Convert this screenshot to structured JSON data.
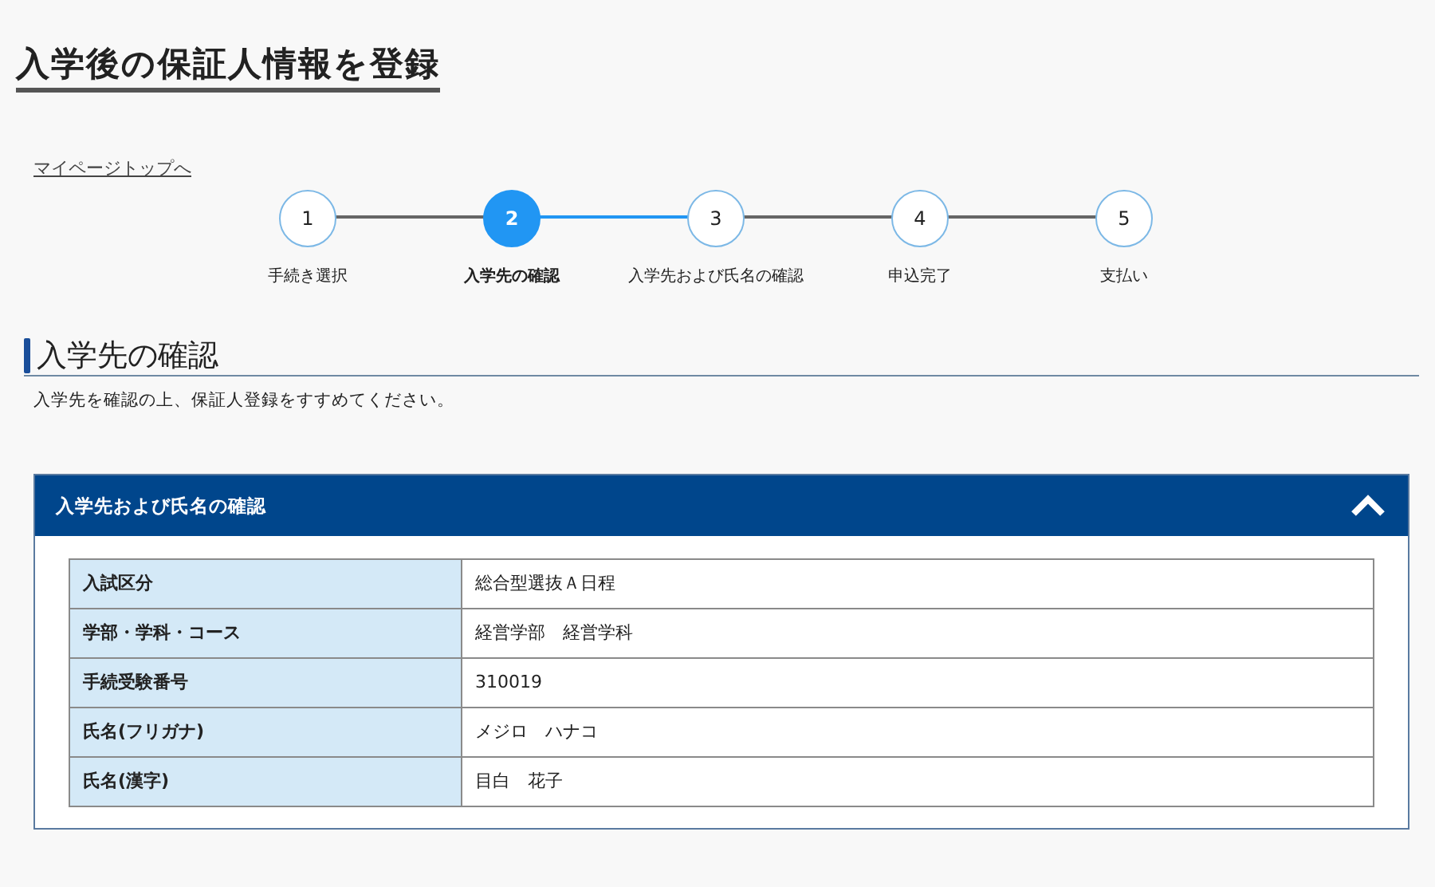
{
  "page_title": "入学後の保証人情報を登録",
  "back_link": "マイページトップへ",
  "steps": [
    {
      "number": "1",
      "label": "手続き選択",
      "selected": false
    },
    {
      "number": "2",
      "label": "入学先の確認",
      "selected": true
    },
    {
      "number": "3",
      "label": "入学先および氏名の確認",
      "selected": false
    },
    {
      "number": "4",
      "label": "申込完了",
      "selected": false
    },
    {
      "number": "5",
      "label": "支払い",
      "selected": false
    }
  ],
  "section": {
    "heading": "入学先の確認",
    "description": "入学先を確認の上、保証人登録をすすめてください。"
  },
  "panel": {
    "title": "入学先および氏名の確認",
    "expanded": true,
    "rows": [
      {
        "label": "入試区分",
        "value": "総合型選抜Ａ日程"
      },
      {
        "label": "学部・学科・コース",
        "value": "経営学部　経営学科"
      },
      {
        "label": "手続受験番号",
        "value": "310019"
      },
      {
        "label": "氏名(フリガナ)",
        "value": "メジロ　ハナコ"
      },
      {
        "label": "氏名(漢字)",
        "value": "目白　花子"
      }
    ]
  }
}
